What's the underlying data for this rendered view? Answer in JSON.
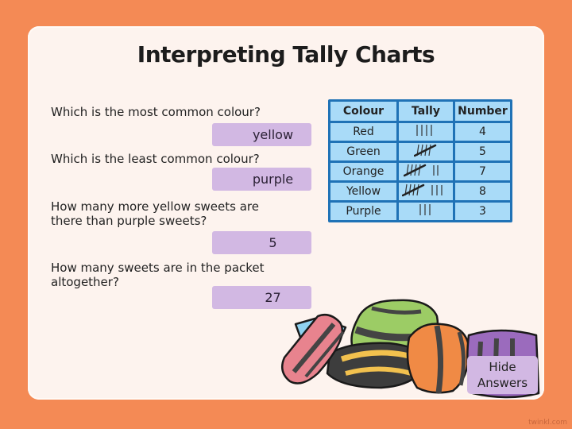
{
  "title": "Interpreting Tally Charts",
  "questions": [
    {
      "question": "Which is the most common colour?",
      "answer": "yellow"
    },
    {
      "question": "Which is the least common colour?",
      "answer": "purple"
    },
    {
      "question_line1": "How many more yellow sweets are",
      "question_line2": "there than purple sweets?",
      "answer": "5"
    },
    {
      "question_line1": "How many sweets are in the packet",
      "question_line2": "altogether?",
      "answer": "27"
    }
  ],
  "table": {
    "headers": [
      "Colour",
      "Tally",
      "Number"
    ],
    "rows": [
      {
        "colour": "Red",
        "tally": "||||",
        "number": "4"
      },
      {
        "colour": "Green",
        "tally": "||||",
        "number": "5"
      },
      {
        "colour": "Orange",
        "tally": "||||  ||",
        "number": "7"
      },
      {
        "colour": "Yellow",
        "tally": "||||  |||",
        "number": "8"
      },
      {
        "colour": "Purple",
        "tally": "|||",
        "number": "3"
      }
    ]
  },
  "hide_button": {
    "line1": "Hide",
    "line2": "Answers"
  },
  "brand": "twinkl.com",
  "colors": {
    "background": "#f48a55",
    "card": "#fdf3ee",
    "answer_box": "#d2b8e3",
    "table_border": "#1f72b6",
    "table_cell": "#a9dbf8"
  }
}
